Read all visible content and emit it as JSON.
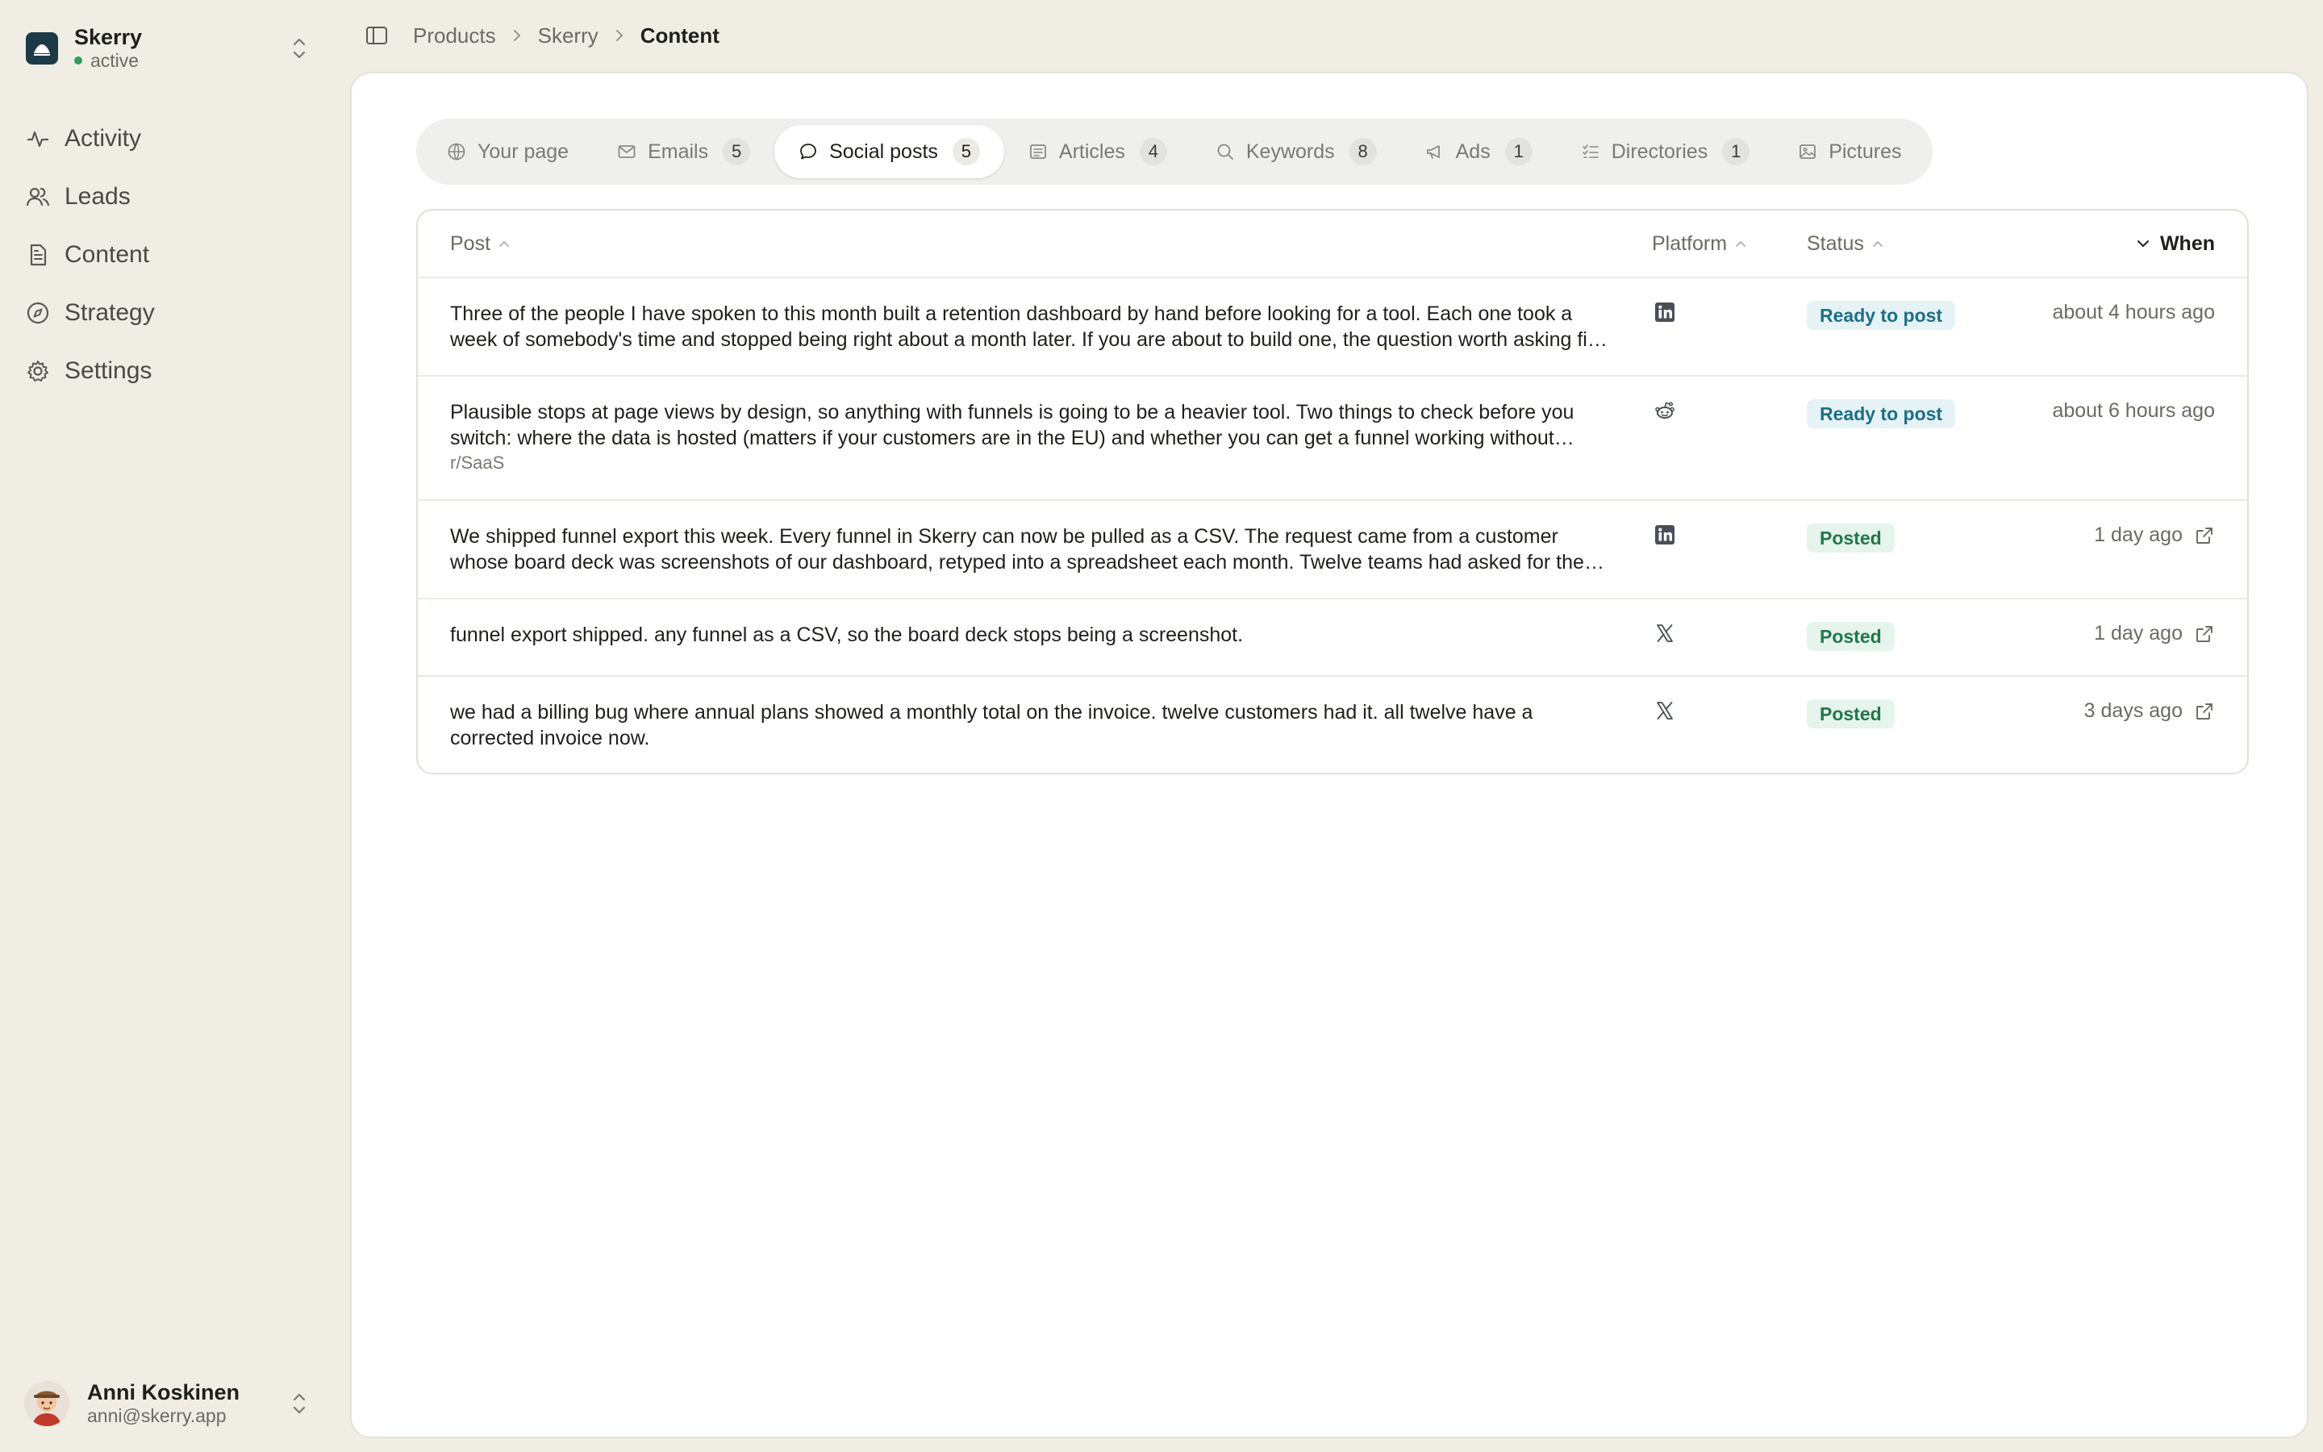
{
  "workspace": {
    "name": "Skerry",
    "status": "active"
  },
  "nav": {
    "items": [
      {
        "label": "Activity",
        "icon": "activity-icon"
      },
      {
        "label": "Leads",
        "icon": "users-icon"
      },
      {
        "label": "Content",
        "icon": "document-icon"
      },
      {
        "label": "Strategy",
        "icon": "compass-icon"
      },
      {
        "label": "Settings",
        "icon": "gear-icon"
      }
    ]
  },
  "user": {
    "name": "Anni Koskinen",
    "email": "anni@skerry.app"
  },
  "breadcrumb": {
    "items": [
      "Products",
      "Skerry"
    ],
    "current": "Content"
  },
  "tabs": [
    {
      "label": "Your page",
      "icon": "globe-icon",
      "count": ""
    },
    {
      "label": "Emails",
      "icon": "mail-icon",
      "count": "5"
    },
    {
      "label": "Social posts",
      "icon": "chat-icon",
      "count": "5"
    },
    {
      "label": "Articles",
      "icon": "article-icon",
      "count": "4"
    },
    {
      "label": "Keywords",
      "icon": "search-icon",
      "count": "8"
    },
    {
      "label": "Ads",
      "icon": "megaphone-icon",
      "count": "1"
    },
    {
      "label": "Directories",
      "icon": "list-icon",
      "count": "1"
    },
    {
      "label": "Pictures",
      "icon": "image-icon",
      "count": ""
    }
  ],
  "table": {
    "columns": {
      "post": "Post",
      "platform": "Platform",
      "status": "Status",
      "when": "When"
    },
    "rows": [
      {
        "text": "Three of the people I have spoken to this month built a retention dashboard by hand before looking for a tool. Each one took a week of somebody's time and stopped being right about a month later. If you are about to build one, the question worth asking first is how much of it you will still maintain in three months.",
        "sub": "",
        "platform": "linkedin",
        "status": "Ready to post",
        "status_kind": "ready",
        "when": "about 4 hours ago",
        "external": false
      },
      {
        "text": "Plausible stops at page views by design, so anything with funnels is going to be a heavier tool. Two things to check before you switch: where the data is hosted (matters if your customers are in the EU) and whether you can get a funnel working without adding a second script.",
        "sub": "r/SaaS",
        "platform": "reddit",
        "status": "Ready to post",
        "status_kind": "ready",
        "when": "about 6 hours ago",
        "external": false
      },
      {
        "text": "We shipped funnel export this week. Every funnel in Skerry can now be pulled as a CSV. The request came from a customer whose board deck was screenshots of our dashboard, retyped into a spreadsheet each month. Twelve teams had asked for the same thing.",
        "sub": "",
        "platform": "linkedin",
        "status": "Posted",
        "status_kind": "posted",
        "when": "1 day ago",
        "external": true
      },
      {
        "text": "funnel export shipped. any funnel as a CSV, so the board deck stops being a screenshot.",
        "sub": "",
        "platform": "x",
        "status": "Posted",
        "status_kind": "posted",
        "when": "1 day ago",
        "external": true
      },
      {
        "text": "we had a billing bug where annual plans showed a monthly total on the invoice. twelve customers had it. all twelve have a corrected invoice now.",
        "sub": "",
        "platform": "x",
        "status": "Posted",
        "status_kind": "posted",
        "when": "3 days ago",
        "external": true
      }
    ]
  },
  "colors": {
    "background": "#efede4",
    "panel": "#ffffff",
    "ready": "#1d6e86",
    "posted": "#22774a",
    "logo": "#1d3b47"
  }
}
